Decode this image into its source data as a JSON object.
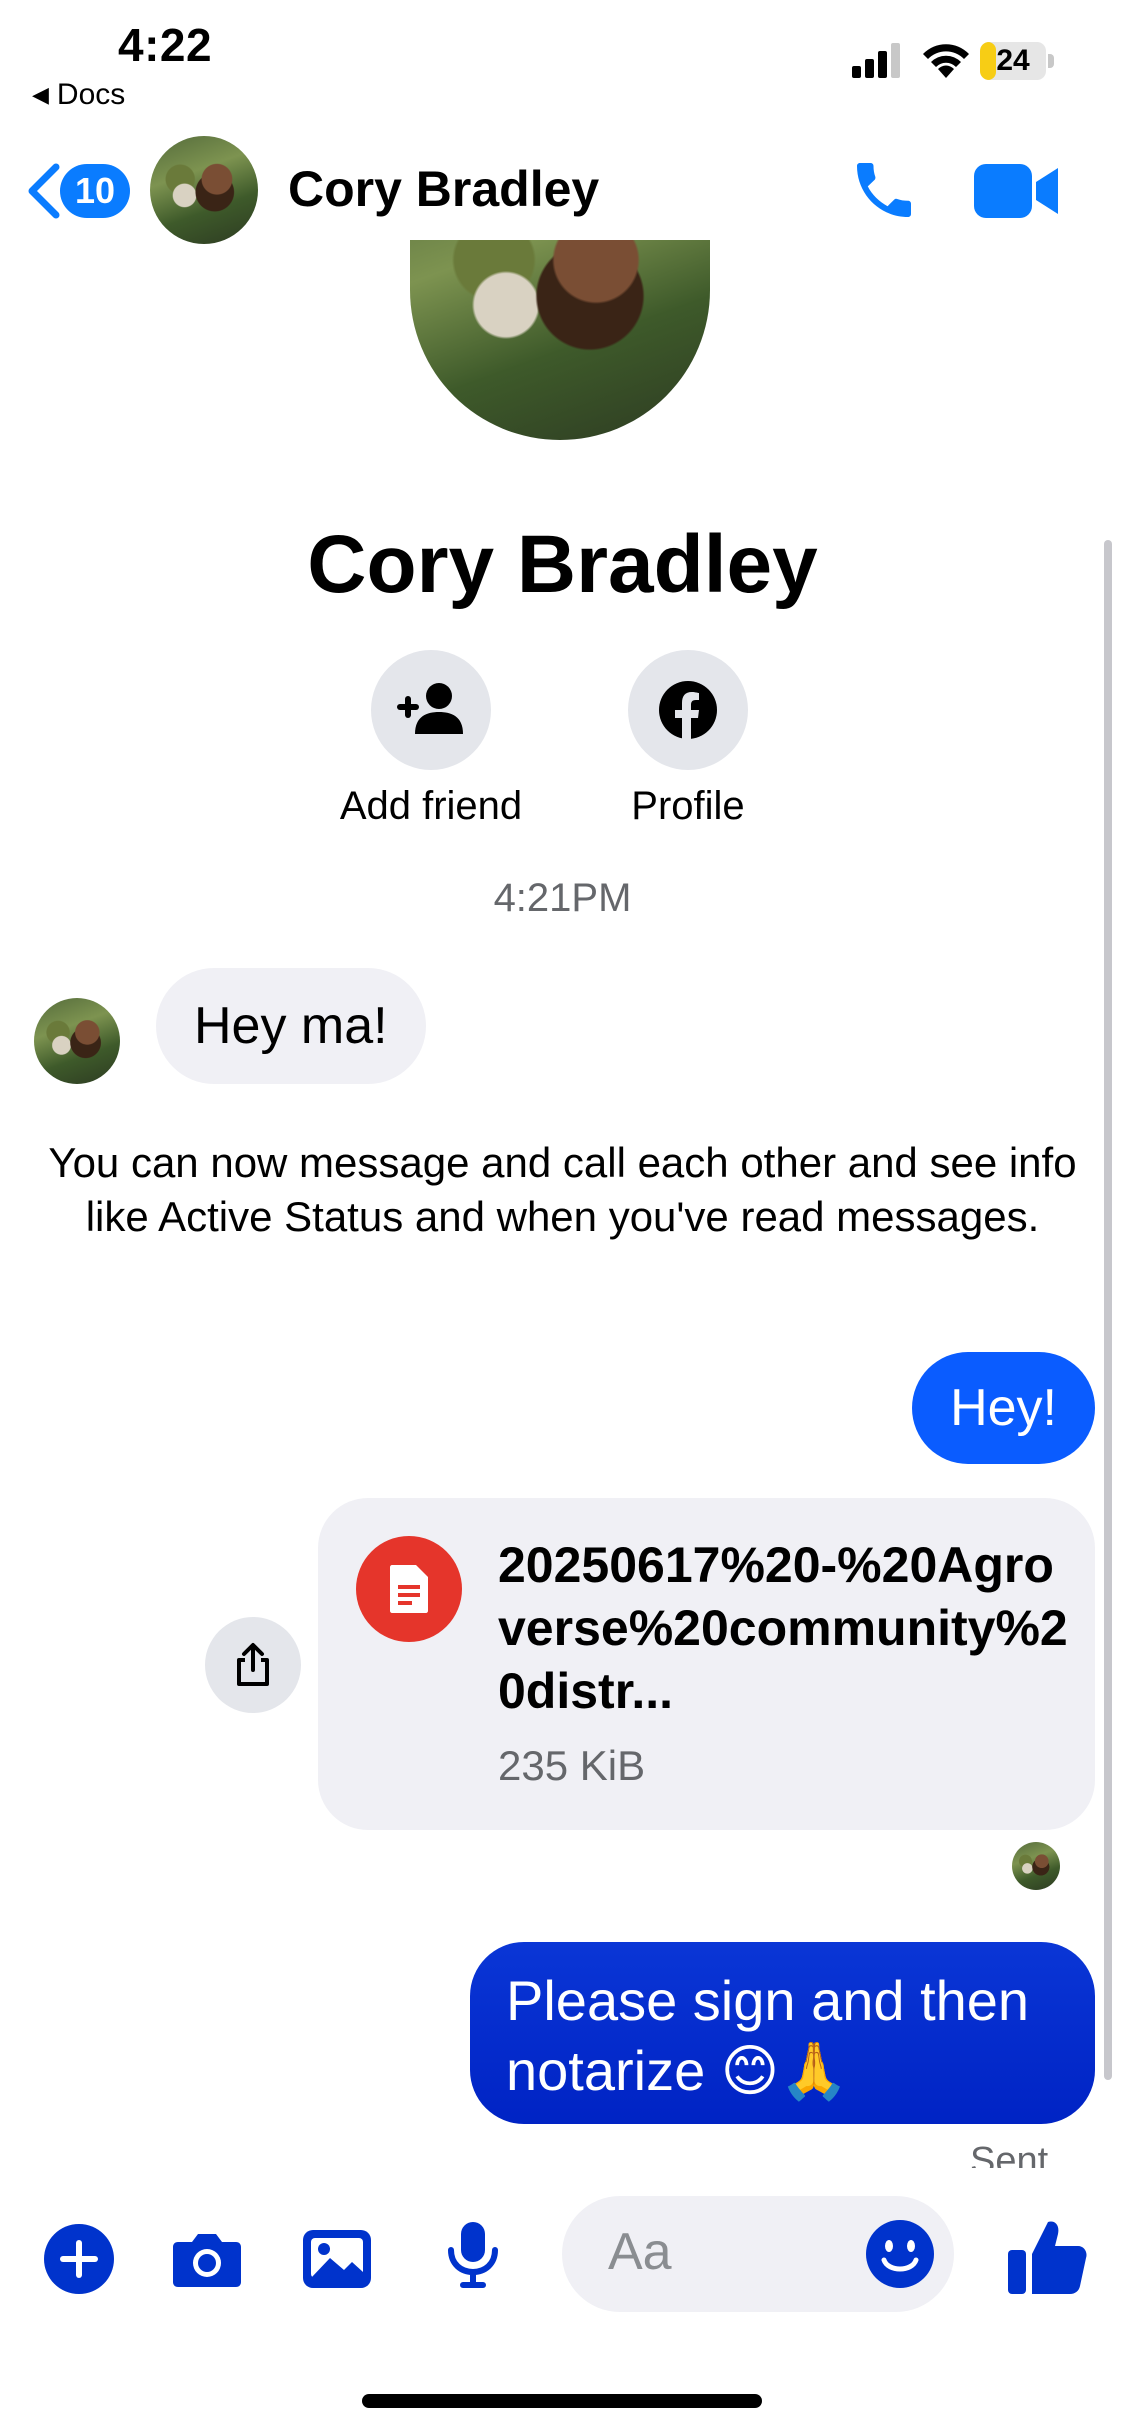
{
  "status_bar": {
    "time": "4:22",
    "back_app": "Docs",
    "battery": "24",
    "battery_level": 0.24
  },
  "nav": {
    "unread_count": "10",
    "contact_name": "Cory Bradley"
  },
  "profile": {
    "name": "Cory Bradley",
    "actions": [
      {
        "label": "Add friend",
        "icon": "add-person-icon"
      },
      {
        "label": "Profile",
        "icon": "facebook-icon"
      }
    ]
  },
  "conversation": {
    "timestamp": "4:21PM",
    "incoming_message": "Hey ma!",
    "system_notice": "You can now message and call each other and see info like Active Status and when you've read messages.",
    "outgoing_message_1": "Hey!",
    "attachment": {
      "file_name": "20250617%20-%20Agroverse%20community%20distr...",
      "file_size": "235 KiB"
    },
    "outgoing_message_2": "Please sign and then notarize 😊🙏",
    "status": "Sent"
  },
  "composer": {
    "placeholder": "Aa"
  },
  "colors": {
    "messenger_blue": "#0a7cff",
    "bubble_blue": "#0a5cff",
    "bubble_dark_blue": "#0023c4",
    "icon_blue": "#0033cc",
    "pdf_red": "#e5352b"
  }
}
